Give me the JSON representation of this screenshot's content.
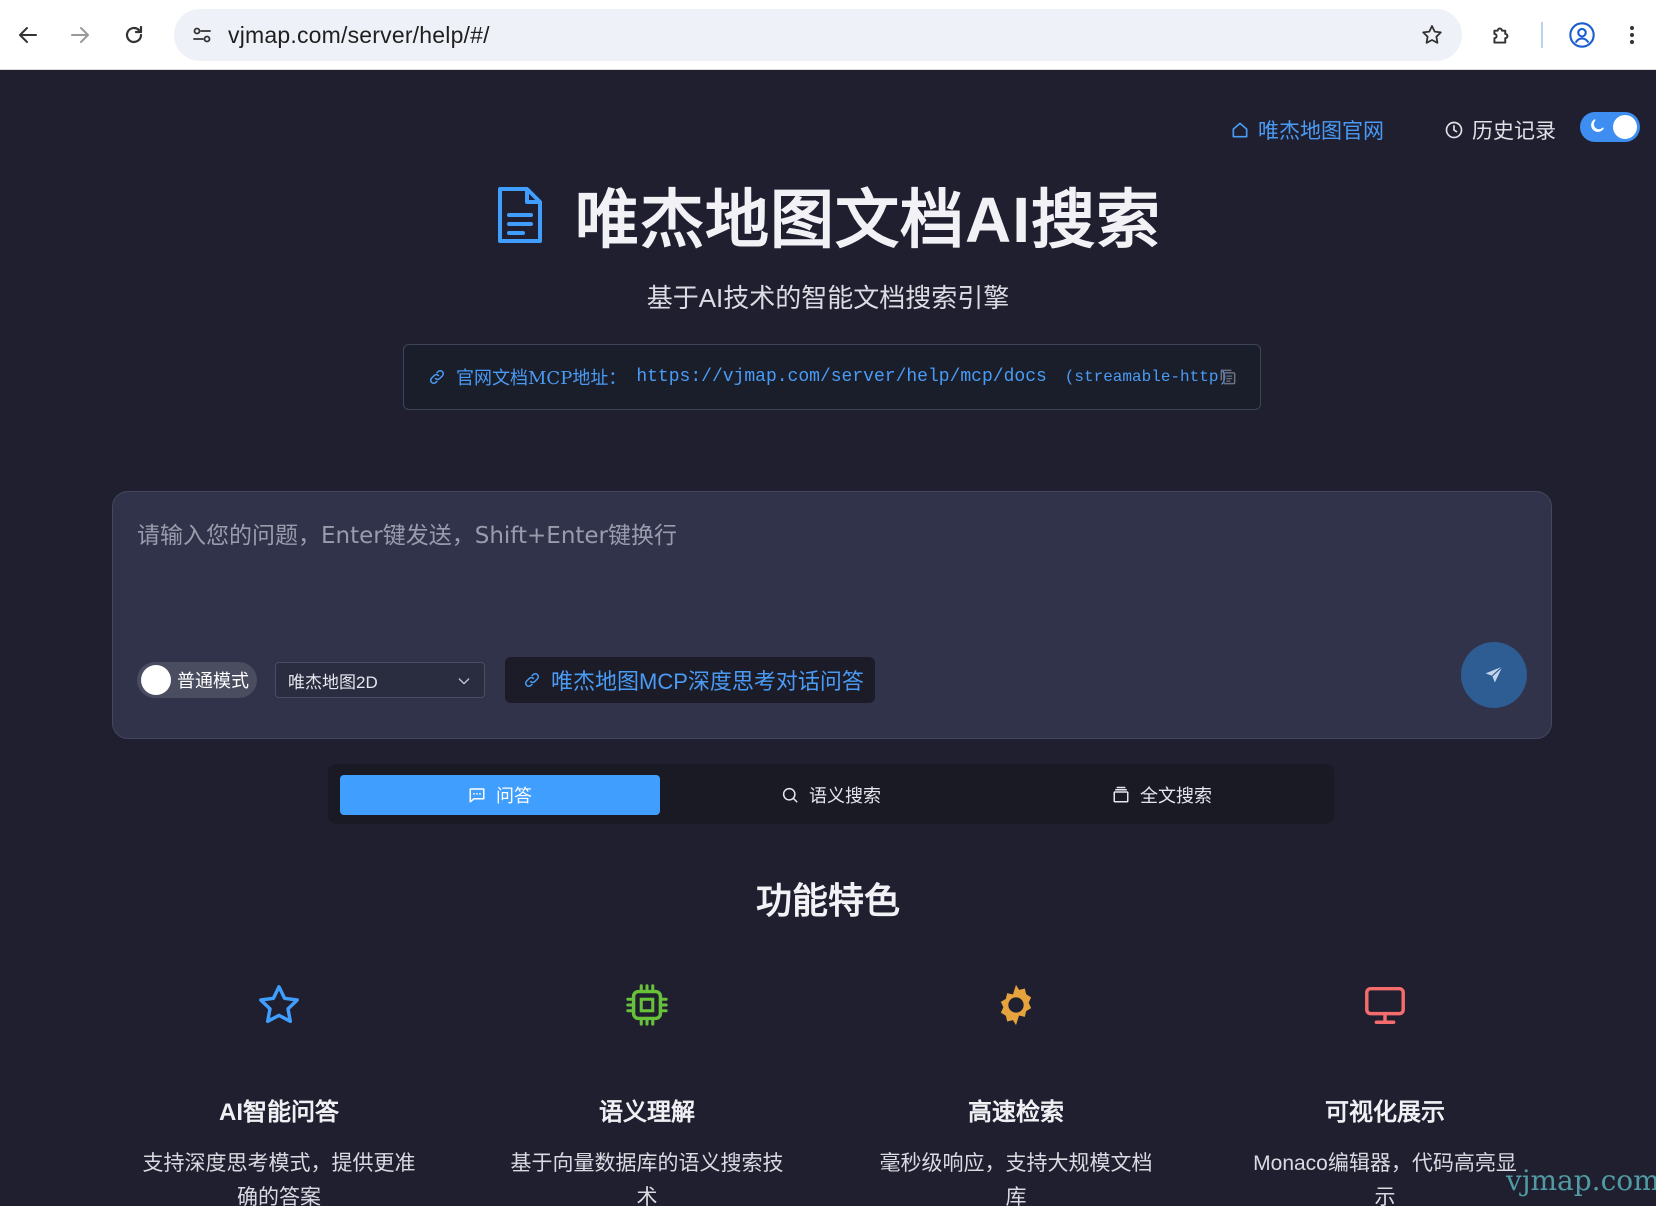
{
  "browser": {
    "url": "vjmap.com/server/help/#/"
  },
  "topnav": {
    "home_label": "唯杰地图官网",
    "history_label": "历史记录"
  },
  "hero": {
    "title": "唯杰地图文档AI搜索",
    "subtitle": "基于AI技术的智能文档搜索引擎"
  },
  "mcp": {
    "label": "官网文档MCP地址：",
    "url": "https://vjmap.com/server/help/mcp/docs",
    "protocol": "(streamable-http)"
  },
  "search": {
    "placeholder": "请输入您的问题，Enter键发送，Shift+Enter键换行",
    "mode_label": "普通模式",
    "map_select_value": "唯杰地图2D",
    "mcp_chat_label": "唯杰地图MCP深度思考对话问答"
  },
  "tabs": [
    {
      "label": "问答",
      "icon": "chat-icon",
      "active": true
    },
    {
      "label": "语义搜索",
      "icon": "search-icon",
      "active": false
    },
    {
      "label": "全文搜索",
      "icon": "stack-icon",
      "active": false
    }
  ],
  "features": {
    "title": "功能特色",
    "items": [
      {
        "title": "AI智能问答",
        "desc": "支持深度思考模式，提供更准确的答案",
        "icon": "star-icon",
        "color": "#409eff"
      },
      {
        "title": "语义理解",
        "desc": "基于向量数据库的语义搜索技术",
        "icon": "cpu-icon",
        "color": "#67c23a"
      },
      {
        "title": "高速检索",
        "desc": "毫秒级响应，支持大规模文档库",
        "icon": "gear-icon",
        "color": "#e6a23c"
      },
      {
        "title": "可视化展示",
        "desc": "Monaco编辑器，代码高亮显示",
        "icon": "monitor-icon",
        "color": "#f56c6c"
      }
    ]
  },
  "watermark": "vjmap.com",
  "colors": {
    "accent": "#409eff",
    "background": "#1f1f30",
    "card": "#31334a"
  }
}
